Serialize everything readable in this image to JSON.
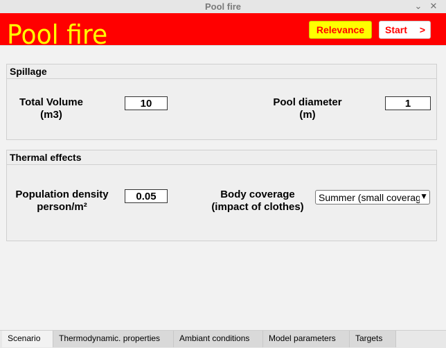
{
  "window": {
    "title": "Pool fire",
    "minimize_icon": "minimize-icon",
    "close_icon": "close-icon"
  },
  "header": {
    "app_title": "Pool fire",
    "relevance_label": "Relevance",
    "start_label": "Start",
    "start_arrow": ">",
    "colors": {
      "background": "#ff0000",
      "title": "#ffff00"
    }
  },
  "spillage": {
    "title": "Spillage",
    "total_volume_label_line1": "Total Volume",
    "total_volume_label_line2": "(m3)",
    "total_volume_value": "10",
    "pool_diameter_label_line1": "Pool diameter",
    "pool_diameter_label_line2": "(m)",
    "pool_diameter_value": "1"
  },
  "thermal": {
    "title": "Thermal effects",
    "population_label_line1": "Population density",
    "population_label_line2": "person/m²",
    "population_value": "0.05",
    "body_label_line1": "Body coverage",
    "body_label_line2": "(impact of clothes)",
    "body_selected": "Summer (small coverage)"
  },
  "tabs": [
    {
      "label": "Scenario"
    },
    {
      "label": "Thermodynamic. properties"
    },
    {
      "label": "Ambiant conditions"
    },
    {
      "label": "Model parameters"
    },
    {
      "label": "Targets"
    }
  ]
}
